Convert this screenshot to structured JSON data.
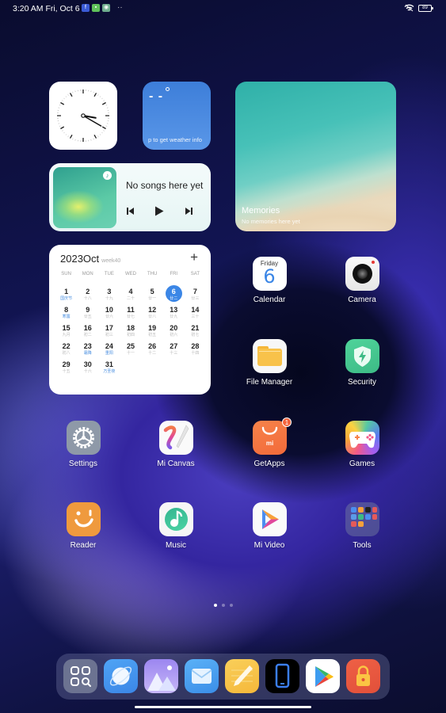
{
  "status_bar": {
    "time_date": "3:20 AM Fri, Oct 6",
    "notification_icons": [
      "facebook-icon",
      "messages-icon",
      "app-store-icon"
    ],
    "more_indicator": "··",
    "wifi_icon": "wifi-icon",
    "battery_level": "89"
  },
  "widgets": {
    "clock": {
      "hour": 3,
      "minute": 20
    },
    "weather": {
      "temperature": "- -",
      "hint": "p to get weather info"
    },
    "music": {
      "title": "No songs here yet",
      "controls": [
        "previous",
        "play",
        "next"
      ]
    },
    "memories": {
      "title": "Memories",
      "subtitle": "No memories here yet"
    },
    "calendar": {
      "title": "2023Oct",
      "week": "week40",
      "add_label": "+",
      "weekdays": [
        "SUN",
        "MON",
        "TUE",
        "WED",
        "THU",
        "FRI",
        "SAT"
      ],
      "leading_blanks": 0,
      "today": 6,
      "days": [
        {
          "n": "1",
          "l": "国庆节",
          "hol": true
        },
        {
          "n": "2",
          "l": "十八"
        },
        {
          "n": "3",
          "l": "十九"
        },
        {
          "n": "4",
          "l": "二十"
        },
        {
          "n": "5",
          "l": "廿一"
        },
        {
          "n": "6",
          "l": "廿二"
        },
        {
          "n": "7",
          "l": "廿三"
        },
        {
          "n": "8",
          "l": "寒露",
          "hol": true
        },
        {
          "n": "9",
          "l": "廿五"
        },
        {
          "n": "10",
          "l": "廿六"
        },
        {
          "n": "11",
          "l": "廿七"
        },
        {
          "n": "12",
          "l": "廿八"
        },
        {
          "n": "13",
          "l": "廿九"
        },
        {
          "n": "14",
          "l": "三十"
        },
        {
          "n": "15",
          "l": "九月"
        },
        {
          "n": "16",
          "l": "初二"
        },
        {
          "n": "17",
          "l": "初三"
        },
        {
          "n": "18",
          "l": "初四"
        },
        {
          "n": "19",
          "l": "初五"
        },
        {
          "n": "20",
          "l": "初六"
        },
        {
          "n": "21",
          "l": "初七"
        },
        {
          "n": "22",
          "l": "初八"
        },
        {
          "n": "23",
          "l": "霜降",
          "hol": true
        },
        {
          "n": "24",
          "l": "重阳",
          "hol": true
        },
        {
          "n": "25",
          "l": "十一"
        },
        {
          "n": "26",
          "l": "十二"
        },
        {
          "n": "27",
          "l": "十三"
        },
        {
          "n": "28",
          "l": "十四"
        },
        {
          "n": "29",
          "l": "十五"
        },
        {
          "n": "30",
          "l": "十六"
        },
        {
          "n": "31",
          "l": "万圣夜",
          "hol": true
        }
      ]
    }
  },
  "apps": [
    {
      "id": "calendar",
      "label": "Calendar",
      "sub": "Friday",
      "day": "6"
    },
    {
      "id": "camera",
      "label": "Camera"
    },
    {
      "id": "file-manager",
      "label": "File Manager"
    },
    {
      "id": "security",
      "label": "Security"
    },
    {
      "id": "settings",
      "label": "Settings"
    },
    {
      "id": "mi-canvas",
      "label": "Mi Canvas"
    },
    {
      "id": "getapps",
      "label": "GetApps",
      "badge": "1",
      "brand": "mi"
    },
    {
      "id": "games",
      "label": "Games"
    },
    {
      "id": "reader",
      "label": "Reader"
    },
    {
      "id": "music",
      "label": "Music"
    },
    {
      "id": "mi-video",
      "label": "Mi Video"
    },
    {
      "id": "tools",
      "label": "Tools"
    }
  ],
  "page_indicator": {
    "pages": 3,
    "current": 1
  },
  "dock": [
    "app-vault",
    "browser",
    "gallery",
    "mail",
    "notes",
    "phone-link",
    "play-store",
    "app-lock"
  ],
  "colors": {
    "accent_blue": "#3b86e6",
    "badge": "#f4623a"
  }
}
